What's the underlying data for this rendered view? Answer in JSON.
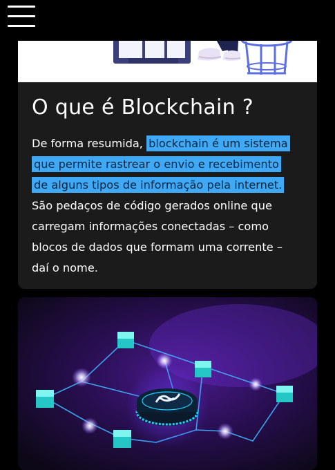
{
  "nav": {
    "menu_icon": "hamburger-menu-icon"
  },
  "article": {
    "title": "O que é Blockchain ?",
    "paragraph": {
      "intro": "De forma resumida,",
      "highlight": "blockchain é um sistema que permite rastrear o envio e recebimento de alguns tipos de informação pela internet.",
      "rest": "São pedaços de código gerados online que carregam informações conectadas – como blocos de dados que formam uma corrente – daí o nome."
    },
    "highlight_color": "#3fa9f5"
  },
  "colors": {
    "page_background": "#000000",
    "card_background": "#1b1b1b",
    "accent_cyan": "#2ee6e6",
    "accent_purple": "#7b2fd0"
  },
  "illustrations": {
    "top": "person-at-computer-illustration",
    "bottom": "blockchain-network-illustration"
  }
}
